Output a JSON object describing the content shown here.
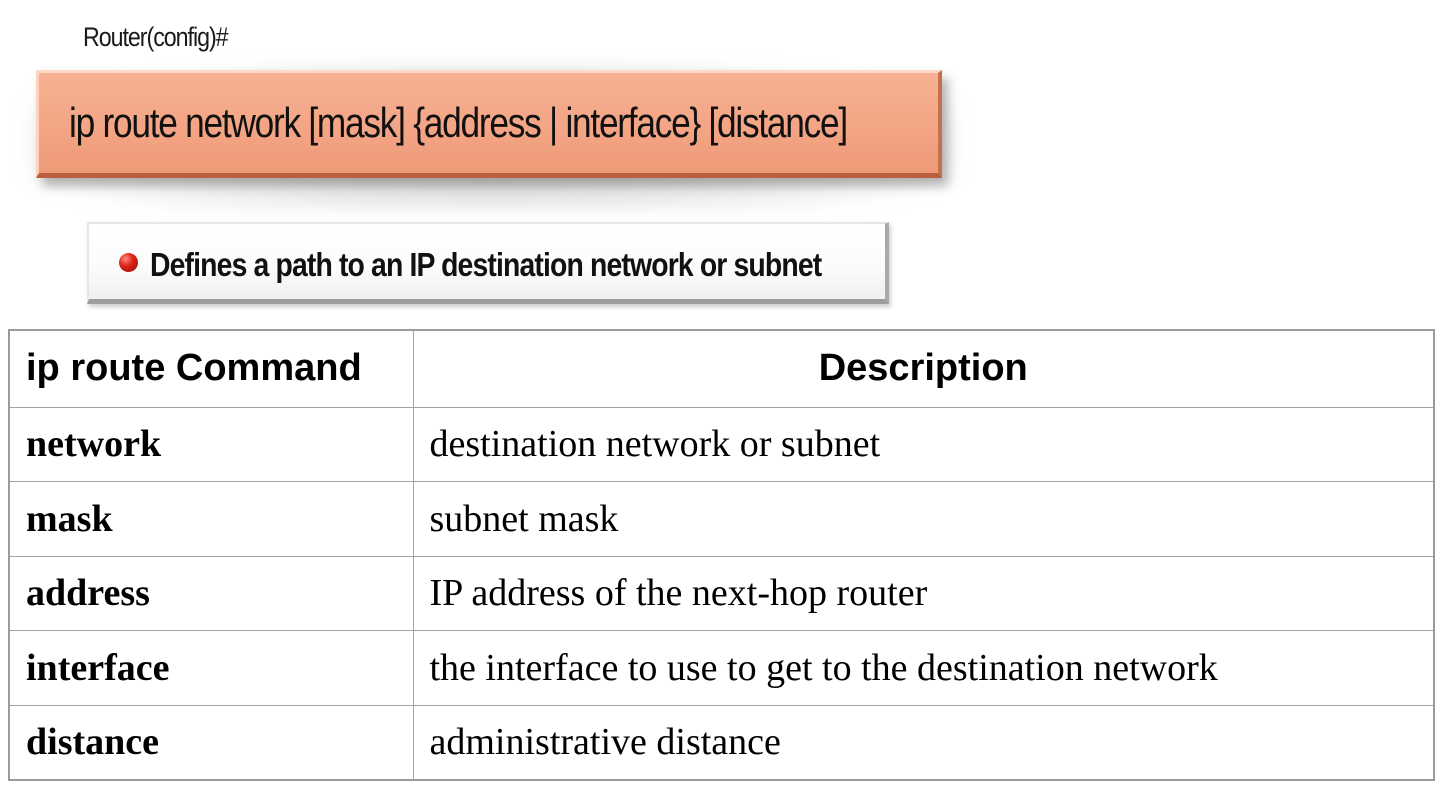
{
  "header": {
    "prompt": "Router(config)#",
    "command_syntax": "ip route network [mask] {address | interface} [distance]",
    "definition": "Defines a path to an IP destination network or subnet"
  },
  "table": {
    "headers": [
      "ip route Command",
      "Description"
    ],
    "rows": [
      {
        "command": "network",
        "description": "destination network or subnet"
      },
      {
        "command": "mask",
        "description": "subnet mask"
      },
      {
        "command": "address",
        "description": "IP address of the next-hop router"
      },
      {
        "command": "interface",
        "description": "the interface to use to get to the destination network"
      },
      {
        "command": "distance",
        "description": "administrative distance"
      }
    ]
  },
  "colors": {
    "command_box": "#f3a585",
    "bullet": "#e0241a"
  }
}
